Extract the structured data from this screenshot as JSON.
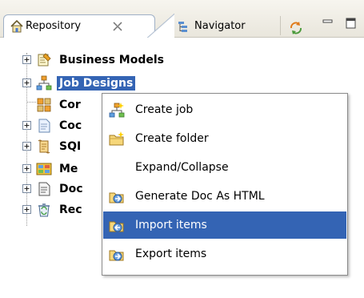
{
  "tabs": [
    {
      "label": "Repository",
      "active": true,
      "closable": true,
      "icon": "repository-house-icon"
    },
    {
      "label": "Navigator",
      "active": false,
      "icon": "navigator-icon"
    }
  ],
  "view_toolbar": [
    "sync-icon",
    "minimize-icon",
    "maximize-icon"
  ],
  "tree": {
    "items": [
      {
        "label": "Business Models",
        "icon": "business-models-icon",
        "expandable": true,
        "selected": false
      },
      {
        "label": "Job Designs",
        "icon": "job-designs-icon",
        "expandable": true,
        "selected": true
      },
      {
        "label": "Cor",
        "icon": "contexts-icon",
        "expandable": false,
        "selected": false
      },
      {
        "label": "Coc",
        "icon": "code-icon",
        "expandable": true,
        "selected": false
      },
      {
        "label": "SQI",
        "icon": "sql-icon",
        "expandable": true,
        "selected": false
      },
      {
        "label": "Me",
        "icon": "metadata-icon",
        "expandable": true,
        "selected": false
      },
      {
        "label": "Doc",
        "icon": "documentation-icon",
        "expandable": true,
        "selected": false
      },
      {
        "label": "Rec",
        "icon": "recycle-bin-icon",
        "expandable": true,
        "selected": false
      }
    ]
  },
  "context_menu": {
    "items": [
      {
        "label": "Create job",
        "icon": "create-job-icon",
        "highlighted": false
      },
      {
        "label": "Create folder",
        "icon": "create-folder-icon",
        "highlighted": false
      },
      {
        "label": "Expand/Collapse",
        "icon": "",
        "highlighted": false
      },
      {
        "label": "Generate Doc As HTML",
        "icon": "generate-doc-icon",
        "highlighted": false
      },
      {
        "label": "Import items",
        "icon": "import-items-icon",
        "highlighted": true
      },
      {
        "label": "Export items",
        "icon": "export-items-icon",
        "highlighted": false
      }
    ]
  },
  "colors": {
    "selection": "#3464b4",
    "selection_text": "#ffffff",
    "tab_border": "#9fb0c6"
  }
}
